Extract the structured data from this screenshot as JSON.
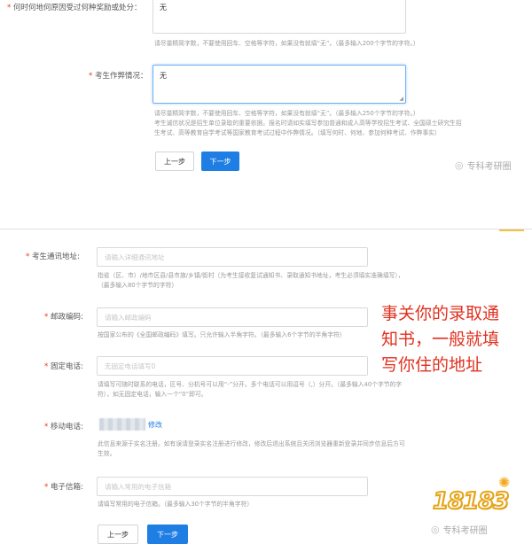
{
  "top_form": {
    "reward_label": "何时何地何原因受过何种奖励或处分：",
    "reward_value": "无",
    "reward_hint": "请尽量精简字数，不要使用回车、空格等字符，如果没有就填“无”。（最多输入200个字节的字符。）",
    "cheat_label": "考生作弊情况：",
    "cheat_value": "无",
    "cheat_hint_1": "请尽量精简字数，不要使用回车、空格等字符，如果没有就填“无”。（最多输入250个字节的字符。）",
    "cheat_hint_2": "考生诚信状况是招生单位录取的重要依据。报名时请如实填写参加普通和成人高等学校招生考试、全国硕士研究生招",
    "cheat_hint_3": "生考试、高等教育自学考试等国家教育考试过程中作弊情况。（填写何时、何地、参加何种考试、作弊事实）",
    "prev_label": "上一步",
    "next_label": "下一步",
    "watermark": "专科考研圈"
  },
  "bottom_form": {
    "address_label": "考生通讯地址:",
    "address_placeholder": "请输入详细通讯地址",
    "address_hint_1": "指省（区、市）/地市区县/县市旗/乡镇/街村（为考生接收复试通知书、录取通知书地址，考生必须填实准确填写），",
    "address_hint_2": "（最多输入80个字节的字符）",
    "postcode_label": "邮政编码:",
    "postcode_placeholder": "请输入邮政编码",
    "postcode_hint": "按国家公布的《全国邮政编码》填写。只允许输入半角字符。（最多输入6个字节的半角字符）",
    "phone_label": "固定电话:",
    "phone_placeholder": "无固定电话填写0",
    "phone_hint_1": "请填写可随时联系的电话，区号、分机号可以用“-”分开。多个电话可以用逗号（,）分开。（最多输入40个字节的字",
    "phone_hint_2": "符），如无固定电话，输入一个“0”即可。",
    "mobile_label": "移动电话:",
    "mobile_edit": "修改",
    "mobile_hint_1": "此信息来源于实名注册。如有误请登录实名注册进行修改，修改后退出系统且关闭浏览器重新登录并同步信息后方可",
    "mobile_hint_2": "生效。",
    "email_label": "电子信箱:",
    "email_placeholder": "请输入常用的电子信箱",
    "email_hint": "请填写常用的电子信箱。（最多输入30个字节的半角字符）",
    "prev_label": "上一步",
    "next_label": "下一步",
    "watermark": "专科考研圈",
    "logo_text": "18183"
  },
  "annotation": {
    "line1": "事关你的录取通",
    "line2": "知书，一般就填",
    "line3": "写你住的地址"
  },
  "colors": {
    "accent": "#1f7ee3",
    "required": "#e8380d",
    "annotation": "#e0311f"
  }
}
